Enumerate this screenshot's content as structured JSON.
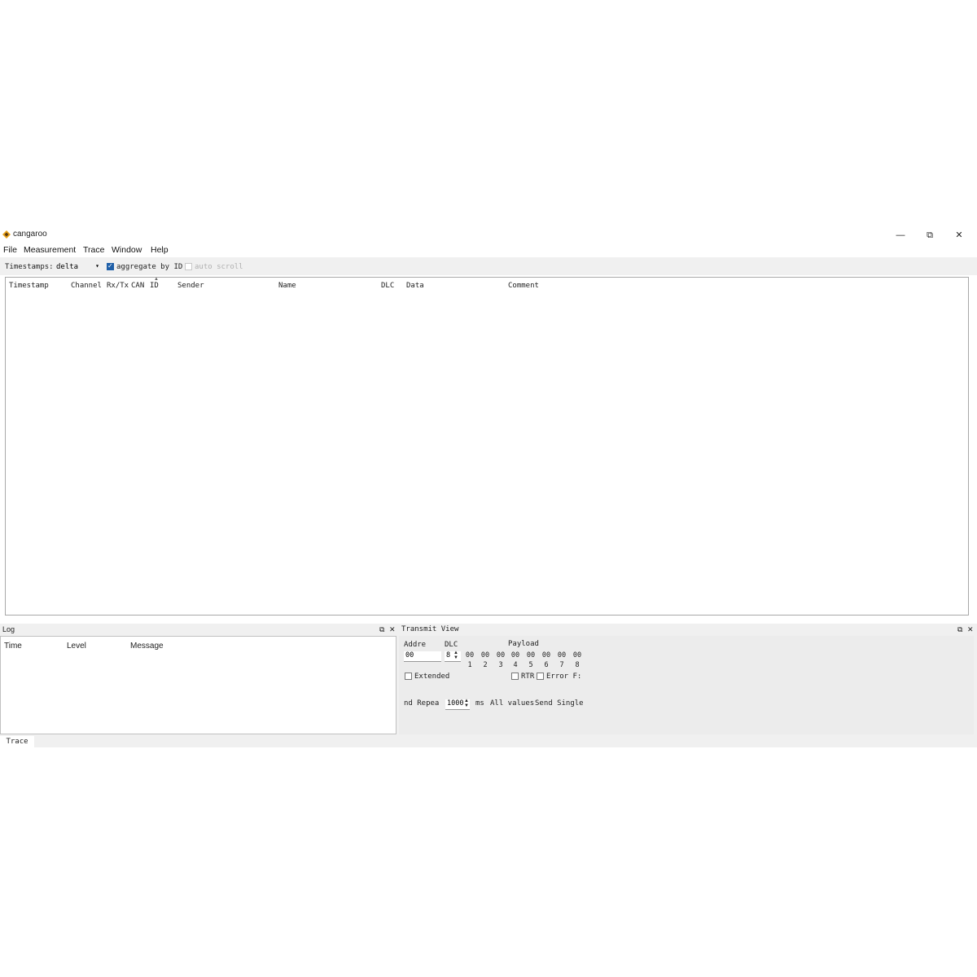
{
  "window": {
    "title": "cangaroo",
    "minimize": "—",
    "restore": "⧉",
    "close": "✕"
  },
  "menu": [
    "File",
    "Measurement",
    "Trace",
    "Window",
    "Help"
  ],
  "toolbar": {
    "timestamps_label": "Timestamps:",
    "timestamps_value": "delta",
    "aggregate_label": "aggregate by ID",
    "aggregate_checked": true,
    "autoscroll_label": "auto scroll",
    "autoscroll_enabled": false
  },
  "trace": {
    "columns": [
      "Timestamp",
      "Channel",
      "Rx/Tx",
      "CAN",
      "ID",
      "Sender",
      "Name",
      "DLC",
      "Data",
      "Comment"
    ]
  },
  "log": {
    "title": "Log",
    "columns": [
      "Time",
      "Level",
      "Message"
    ]
  },
  "transmit": {
    "title": "Transmit View",
    "address_label": "Addre",
    "dlc_label": "DLC",
    "payload_label": "Payload",
    "address_value": "00",
    "dlc_value": "8",
    "bytes": [
      "00",
      "00",
      "00",
      "00",
      "00",
      "00",
      "00",
      "00"
    ],
    "byte_index": [
      "1",
      "2",
      "3",
      "4",
      "5",
      "6",
      "7",
      "8"
    ],
    "extended_label": "Extended",
    "rtr_label": "RTR",
    "error_label": "Error F:",
    "repeat_label": "nd Repea",
    "repeat_value": "1000",
    "ms_label": "ms",
    "all_values_label": "All values",
    "send_single_label": "Send Single"
  },
  "dock_controls": {
    "float": "⧉",
    "close": "✕"
  },
  "tabs": [
    "Trace"
  ]
}
